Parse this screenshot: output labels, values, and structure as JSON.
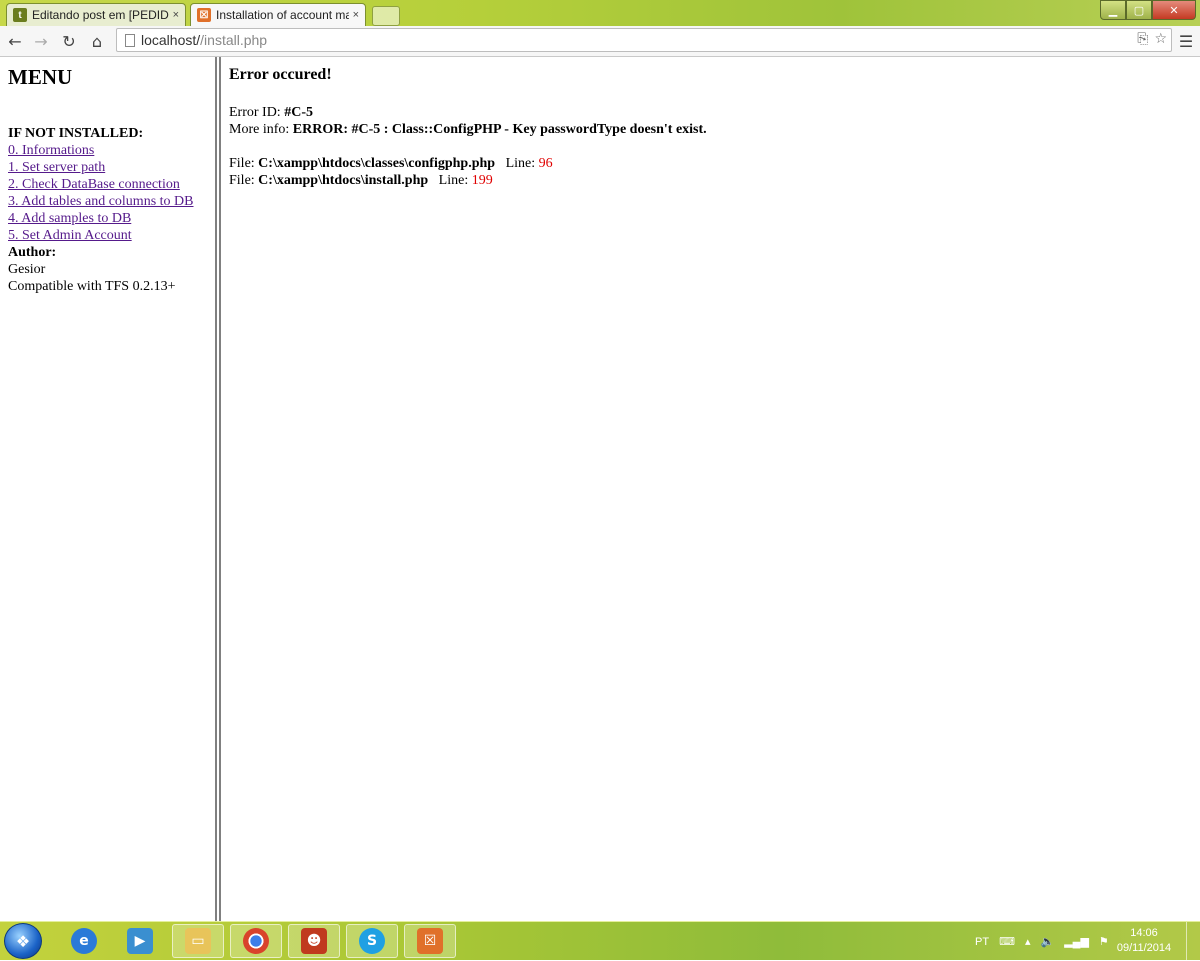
{
  "browser": {
    "tabs": [
      {
        "label": "Editando post em [PEDIDO",
        "favicon": "t",
        "favicon_color": "#6b7d1e"
      },
      {
        "label": "Installation of account ma",
        "favicon": "☒",
        "favicon_color": "#e0702a"
      }
    ],
    "close_glyph": "×",
    "url_host": "localhost/",
    "url_path": "/install.php"
  },
  "sidebar": {
    "title": "MENU",
    "section_heading": "IF NOT INSTALLED:",
    "links": [
      "0. Informations",
      "1. Set server path",
      "2. Check DataBase connection",
      "3. Add tables and columns to DB",
      "4. Add samples to DB",
      "5. Set Admin Account"
    ],
    "author_label": "Author:",
    "author_name": "Gesior",
    "compat": "Compatible with TFS 0.2.13+"
  },
  "main": {
    "title": "Error occured!",
    "error_id_label": "Error ID: ",
    "error_id": "#C-5",
    "more_info_label": "More info: ",
    "more_info": "ERROR: #C-5 : Class::ConfigPHP - Key passwordType doesn't exist.",
    "trace": [
      {
        "file_label": "File: ",
        "file": "C:\\xampp\\htdocs\\classes\\configphp.php",
        "line_label": "Line: ",
        "line": "96"
      },
      {
        "file_label": "File: ",
        "file": "C:\\xampp\\htdocs\\install.php",
        "line_label": "Line: ",
        "line": "199"
      }
    ]
  },
  "taskbar": {
    "tray_lang": "PT",
    "time": "14:06",
    "date": "09/11/2014"
  },
  "colors": {
    "link_visited": "#551a8b",
    "line_number": "#e00000"
  }
}
